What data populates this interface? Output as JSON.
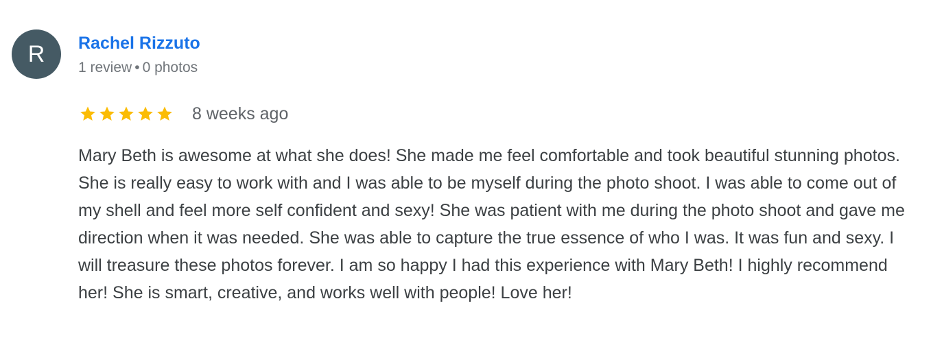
{
  "reviewer": {
    "initial": "R",
    "name": "Rachel Rizzuto",
    "review_count": "1 review",
    "separator": "•",
    "photo_count": "0 photos"
  },
  "rating": {
    "stars": 5,
    "max_stars": 5,
    "time": "8 weeks ago"
  },
  "review_text": "Mary Beth is awesome at what she does! She made me feel comfortable and took beautiful stunning photos. She is really easy to work with and I was able to be myself during the photo shoot. I was able to come out of my shell and feel more self confident and sexy! She was patient with me during the photo shoot and gave me direction when it was needed. She was able to capture the true essence of who I was. It was fun and sexy. I will treasure these photos forever. I am so happy I had this experience with Mary Beth! I highly recommend her! She is smart, creative, and works well with people! Love her!",
  "colors": {
    "avatar_bg": "#455a64",
    "name_link": "#1a73e8",
    "star": "#fbbc04"
  },
  "icons": {
    "star": "star-icon"
  }
}
